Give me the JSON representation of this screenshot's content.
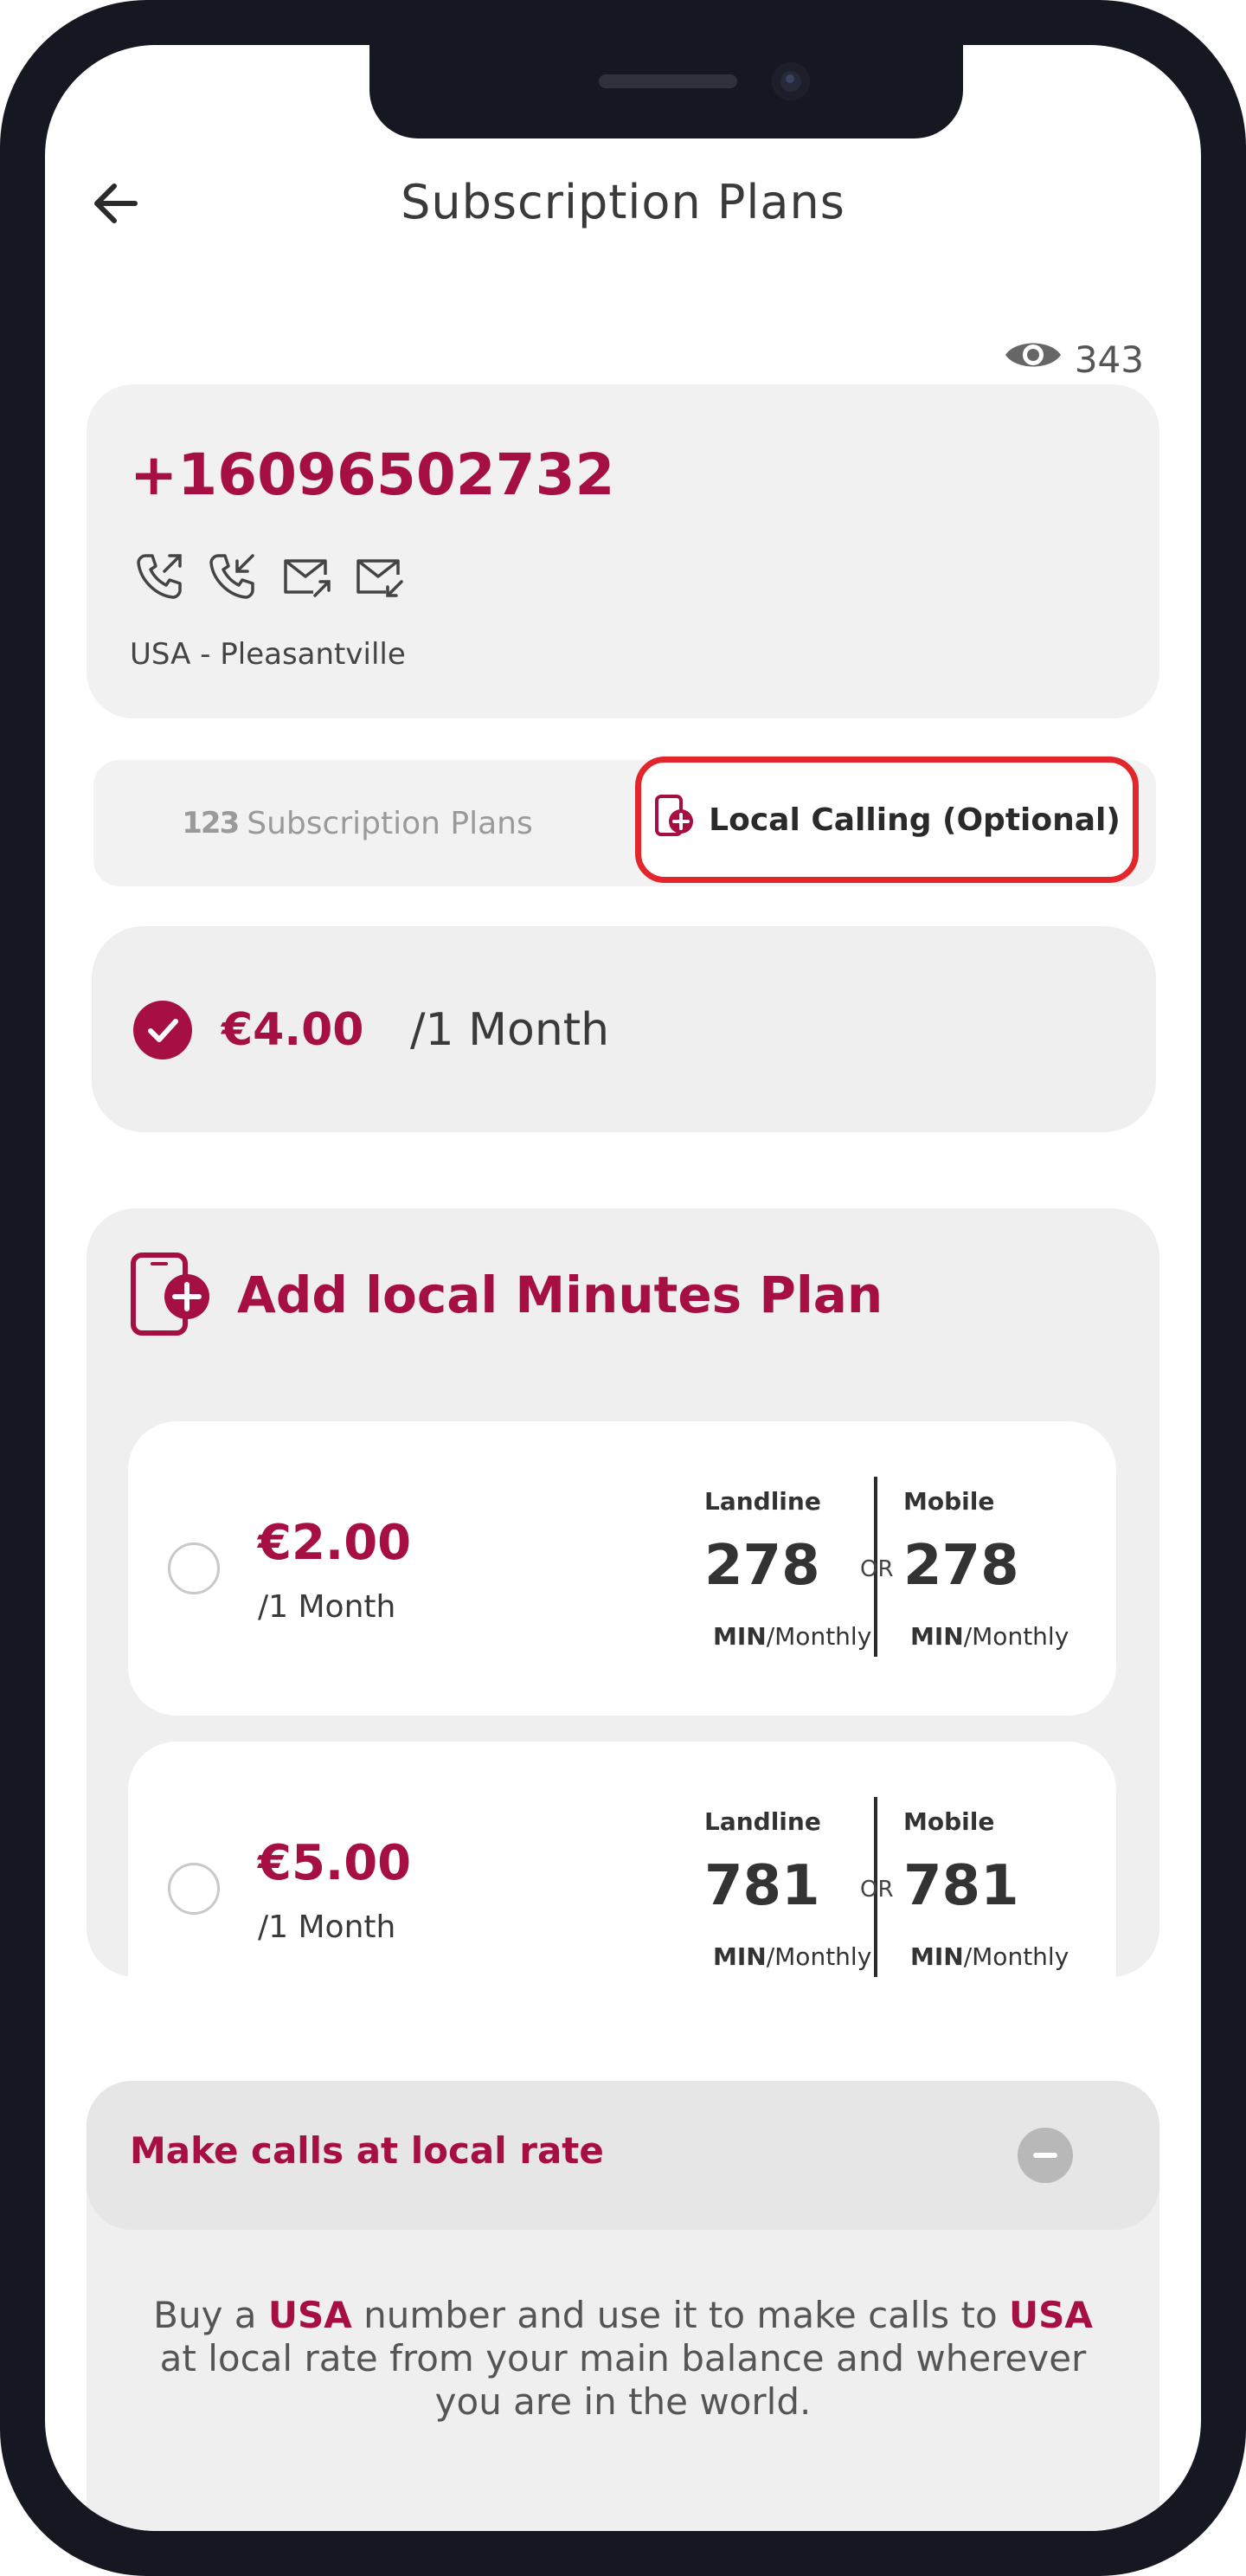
{
  "header": {
    "title": "Subscription Plans",
    "views": "343"
  },
  "number": {
    "phone": "+16096502732",
    "capabilities": [
      "outgoing-call-icon",
      "incoming-call-icon",
      "outgoing-sms-icon",
      "incoming-sms-icon"
    ],
    "location": "USA - Pleasantville"
  },
  "tabs": {
    "subscription": {
      "label": "Subscription Plans",
      "icon_text": "123"
    },
    "local": {
      "label": "Local Calling (Optional)"
    }
  },
  "selected_plan": {
    "price": "€4.00",
    "period": "/1 Month",
    "checked": true
  },
  "local_minutes": {
    "title": "Add local Minutes Plan",
    "column_landline": "Landline",
    "column_mobile": "Mobile",
    "or_text": "OR",
    "unit_min": "MIN",
    "unit_period": "/Monthly",
    "options": [
      {
        "price": "€2.00",
        "period": "/1 Month",
        "landline": "278",
        "mobile": "278"
      },
      {
        "price": "€5.00",
        "period": "/1 Month",
        "landline": "781",
        "mobile": "781"
      }
    ]
  },
  "faq": {
    "title": "Make calls at local rate",
    "body_1": "Buy a ",
    "body_country_1": "USA",
    "body_2": " number and use it to make calls to ",
    "body_country_2": "USA",
    "body_3": " at local rate from your main balance and wherever you are in the world."
  },
  "colors": {
    "brand": "#a50f44",
    "highlight_border": "#e2262c"
  }
}
